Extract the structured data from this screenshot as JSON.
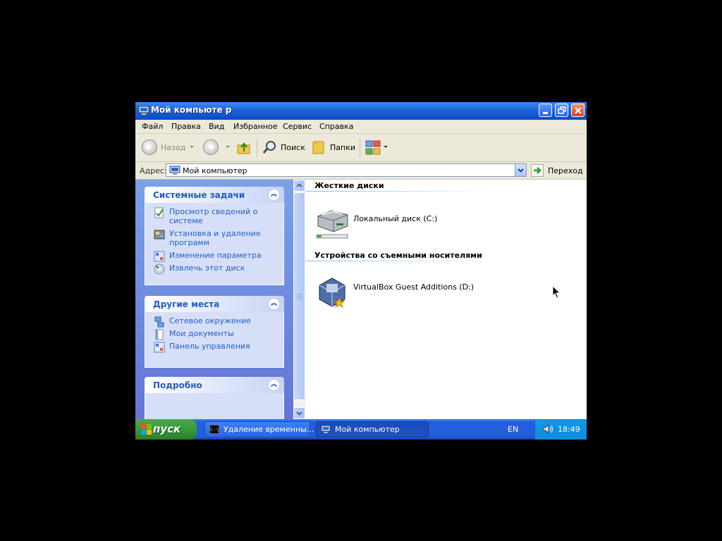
{
  "window": {
    "title": "Мой компьюте р"
  },
  "menu": [
    "Файл",
    "Правка",
    "Вид",
    "Избранное",
    "Сервис",
    "Справка"
  ],
  "toolbar": {
    "back_label": "Назад",
    "search_label": "Поиск",
    "folders_label": "Папки"
  },
  "address": {
    "label": "Адрес:",
    "value": "Мой компьютер",
    "go_label": "Переход"
  },
  "tasks": {
    "system": {
      "title": "Системные задачи",
      "items": [
        {
          "label": "Просмотр сведений о системе",
          "icon": "system-info-icon"
        },
        {
          "label": "Установка и удаление программ",
          "icon": "add-remove-programs-icon"
        },
        {
          "label": "Изменение параметра",
          "icon": "control-panel-icon"
        },
        {
          "label": "Извлечь этот диск",
          "icon": "eject-disc-icon"
        }
      ]
    },
    "other": {
      "title": "Другие места",
      "items": [
        {
          "label": "Сетевое окружение",
          "icon": "network-icon"
        },
        {
          "label": "Мои документы",
          "icon": "documents-icon"
        },
        {
          "label": "Панель управления",
          "icon": "control-panel-icon"
        }
      ]
    },
    "details": {
      "title": "Подробно"
    }
  },
  "content": {
    "hard_drives_title": "Жесткие диски",
    "hard_drives": [
      {
        "label": "Локальный диск (C:)",
        "icon": "hard-drive-icon"
      }
    ],
    "removable_title": "Устройства со съемными носителями",
    "removable": [
      {
        "label": "VirtualBox Guest Additions (D:)",
        "icon": "virtualbox-cd-icon"
      }
    ]
  },
  "taskbar": {
    "start_label": "пуск",
    "buttons": [
      {
        "label": "Удаление временны...",
        "icon": "cmd-icon"
      },
      {
        "label": "Мой компьютер",
        "icon": "my-computer-icon"
      }
    ],
    "lang": "EN",
    "clock": "18:49"
  },
  "colors": {
    "titlebar": "#1d62d8",
    "taskpane": "#6f8fe0",
    "task_link": "#215dc6",
    "start_green": "#379b37"
  }
}
